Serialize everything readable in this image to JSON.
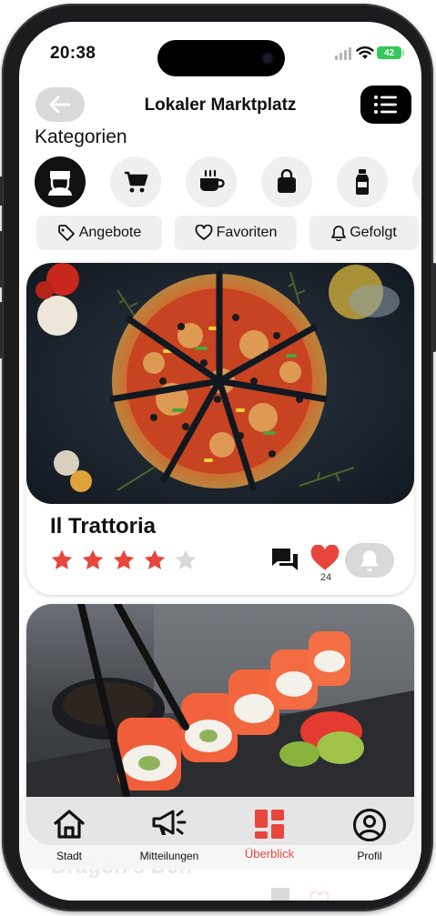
{
  "status_bar": {
    "time": "20:38",
    "battery": "42"
  },
  "header": {
    "title": "Lokaler Marktplatz"
  },
  "categories": {
    "title": "Kategorien",
    "items": [
      {
        "icon": "chef-icon",
        "active": true
      },
      {
        "icon": "cart-icon",
        "active": false
      },
      {
        "icon": "coffee-icon",
        "active": false
      },
      {
        "icon": "shopping-bag-icon",
        "active": false
      },
      {
        "icon": "bottle-icon",
        "active": false
      }
    ]
  },
  "filters": [
    {
      "label": "Angebote",
      "icon": "tag-icon"
    },
    {
      "label": "Favoriten",
      "icon": "heart-outline-icon"
    },
    {
      "label": "Gefolgt",
      "icon": "bell-icon"
    }
  ],
  "cards": [
    {
      "title": "Il Trattoria",
      "rating": 4,
      "rating_max": 5,
      "likes": "24",
      "image": "pizza"
    },
    {
      "title": "Dragon's Den",
      "image": "sushi"
    }
  ],
  "nav": [
    {
      "label": "Stadt",
      "icon": "home-icon",
      "active": false
    },
    {
      "label": "Mitteilungen",
      "icon": "megaphone-icon",
      "active": false
    },
    {
      "label": "Überblick",
      "icon": "dashboard-icon",
      "active": true
    },
    {
      "label": "Profil",
      "icon": "profile-icon",
      "active": false
    }
  ],
  "colors": {
    "accent": "#E8453C",
    "star_empty": "#D9D9D9",
    "chip_bg": "#EFEFEF",
    "battery": "#34C759"
  }
}
